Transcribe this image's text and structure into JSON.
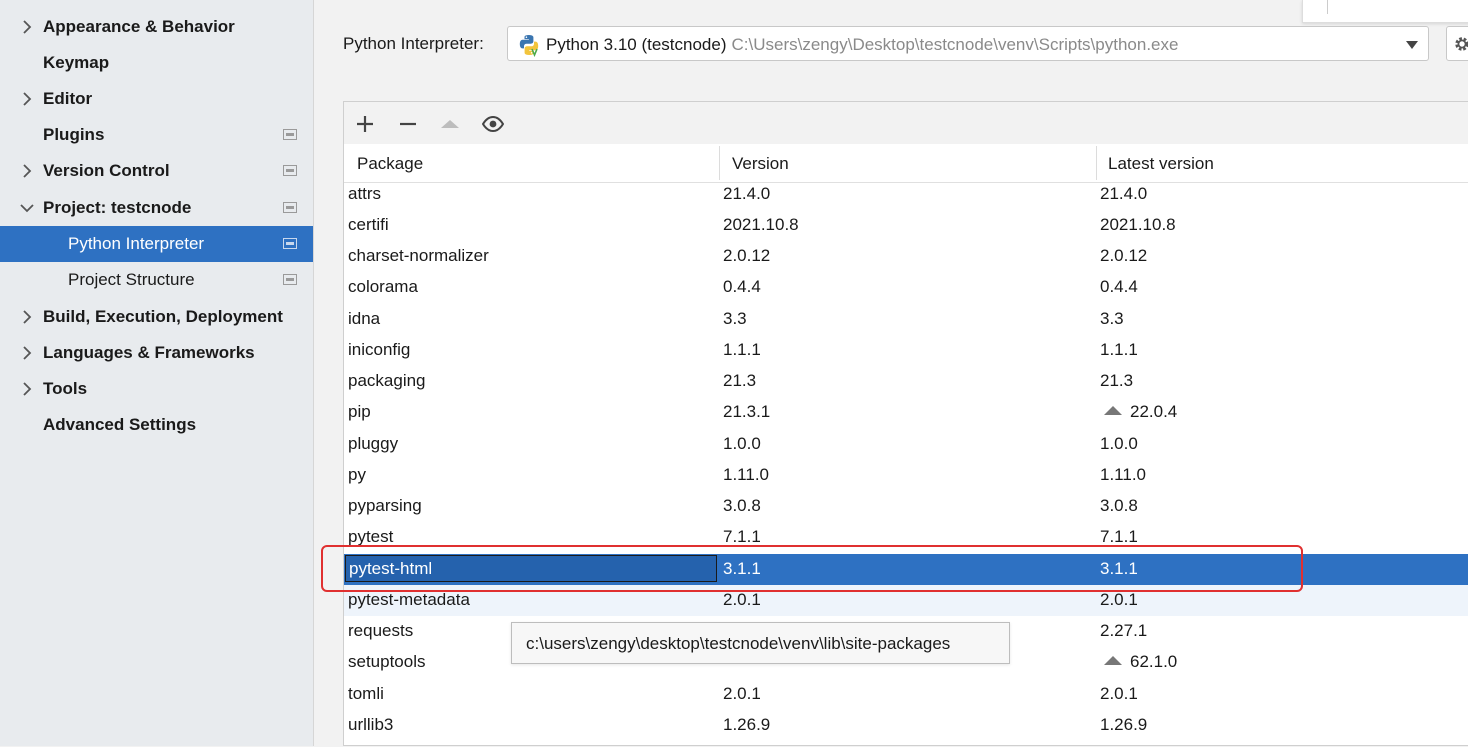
{
  "sidebar": {
    "items": [
      {
        "label": "Appearance & Behavior",
        "expandable": true,
        "expanded": false,
        "child": false,
        "project_icon": false,
        "selected": false
      },
      {
        "label": "Keymap",
        "expandable": false,
        "expanded": false,
        "child": false,
        "project_icon": false,
        "selected": false
      },
      {
        "label": "Editor",
        "expandable": true,
        "expanded": false,
        "child": false,
        "project_icon": false,
        "selected": false
      },
      {
        "label": "Plugins",
        "expandable": false,
        "expanded": false,
        "child": false,
        "project_icon": true,
        "selected": false
      },
      {
        "label": "Version Control",
        "expandable": true,
        "expanded": false,
        "child": false,
        "project_icon": true,
        "selected": false
      },
      {
        "label": "Project: testcnode",
        "expandable": true,
        "expanded": true,
        "child": false,
        "project_icon": true,
        "selected": false
      },
      {
        "label": "Python Interpreter",
        "expandable": false,
        "expanded": false,
        "child": true,
        "project_icon": true,
        "selected": true
      },
      {
        "label": "Project Structure",
        "expandable": false,
        "expanded": false,
        "child": true,
        "project_icon": true,
        "selected": false
      },
      {
        "label": "Build, Execution, Deployment",
        "expandable": true,
        "expanded": false,
        "child": false,
        "project_icon": false,
        "selected": false
      },
      {
        "label": "Languages & Frameworks",
        "expandable": true,
        "expanded": false,
        "child": false,
        "project_icon": false,
        "selected": false
      },
      {
        "label": "Tools",
        "expandable": true,
        "expanded": false,
        "child": false,
        "project_icon": false,
        "selected": false
      },
      {
        "label": "Advanced Settings",
        "expandable": false,
        "expanded": false,
        "child": false,
        "project_icon": false,
        "selected": false
      }
    ]
  },
  "interpreter": {
    "label": "Python Interpreter:",
    "selected_name": "Python 3.10 (testcnode)",
    "selected_path": "C:\\Users\\zengy\\Desktop\\testcnode\\venv\\Scripts\\python.exe"
  },
  "toolbar": {
    "icons": [
      "plus-icon",
      "minus-icon",
      "upgrade-icon",
      "eye-icon"
    ]
  },
  "table": {
    "columns": [
      "Package",
      "Version",
      "Latest version"
    ],
    "rows": [
      {
        "package": "attrs",
        "version": "21.4.0",
        "latest": "21.4.0",
        "upgrade": false
      },
      {
        "package": "certifi",
        "version": "2021.10.8",
        "latest": "2021.10.8",
        "upgrade": false
      },
      {
        "package": "charset-normalizer",
        "version": "2.0.12",
        "latest": "2.0.12",
        "upgrade": false
      },
      {
        "package": "colorama",
        "version": "0.4.4",
        "latest": "0.4.4",
        "upgrade": false
      },
      {
        "package": "idna",
        "version": "3.3",
        "latest": "3.3",
        "upgrade": false
      },
      {
        "package": "iniconfig",
        "version": "1.1.1",
        "latest": "1.1.1",
        "upgrade": false
      },
      {
        "package": "packaging",
        "version": "21.3",
        "latest": "21.3",
        "upgrade": false
      },
      {
        "package": "pip",
        "version": "21.3.1",
        "latest": "22.0.4",
        "upgrade": true
      },
      {
        "package": "pluggy",
        "version": "1.0.0",
        "latest": "1.0.0",
        "upgrade": false
      },
      {
        "package": "py",
        "version": "1.11.0",
        "latest": "1.11.0",
        "upgrade": false
      },
      {
        "package": "pyparsing",
        "version": "3.0.8",
        "latest": "3.0.8",
        "upgrade": false
      },
      {
        "package": "pytest",
        "version": "7.1.1",
        "latest": "7.1.1",
        "upgrade": false
      },
      {
        "package": "pytest-html",
        "version": "3.1.1",
        "latest": "3.1.1",
        "upgrade": false,
        "selected": true
      },
      {
        "package": "pytest-metadata",
        "version": "2.0.1",
        "latest": "2.0.1",
        "upgrade": false,
        "alt": true
      },
      {
        "package": "requests",
        "version": "",
        "latest": "2.27.1",
        "upgrade": false
      },
      {
        "package": "setuptools",
        "version": "",
        "latest": "62.1.0",
        "upgrade": true
      },
      {
        "package": "tomli",
        "version": "2.0.1",
        "latest": "2.0.1",
        "upgrade": false
      },
      {
        "package": "urllib3",
        "version": "1.26.9",
        "latest": "1.26.9",
        "upgrade": false
      }
    ]
  },
  "tooltip": {
    "text": "c:\\users\\zengy\\desktop\\testcnode\\venv\\lib\\site-packages"
  },
  "colors": {
    "selection": "#2e71c2",
    "highlight_box": "#e03030",
    "sidebar_bg": "#e8ebee"
  }
}
